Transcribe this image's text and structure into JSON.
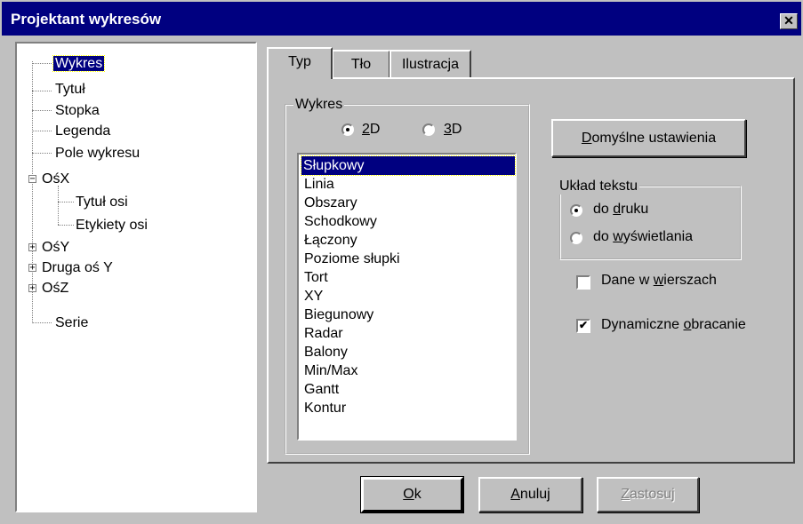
{
  "window": {
    "title": "Projektant wykresów",
    "close_glyph": "✕"
  },
  "tree": {
    "items": [
      {
        "label": "Wykres",
        "selected": true
      },
      {
        "label": "Tytuł"
      },
      {
        "label": "Stopka"
      },
      {
        "label": "Legenda"
      },
      {
        "label": "Pole wykresu"
      },
      {
        "label": "OśX",
        "expander": "−"
      },
      {
        "label": "Tytuł osi"
      },
      {
        "label": "Etykiety osi"
      },
      {
        "label": "OśY",
        "expander": "+"
      },
      {
        "label": "Druga oś Y",
        "expander": "+"
      },
      {
        "label": "OśZ",
        "expander": "+"
      },
      {
        "label": "Serie"
      }
    ]
  },
  "tabs": [
    {
      "label": "Typ",
      "active": true
    },
    {
      "label": "Tło"
    },
    {
      "label": "Ilustracja"
    }
  ],
  "chart_group": {
    "legend": "Wykres",
    "radio_2d": {
      "prefix": "",
      "accel": "2",
      "suffix": "D",
      "checked": true
    },
    "radio_3d": {
      "prefix": "",
      "accel": "3",
      "suffix": "D",
      "checked": false
    }
  },
  "chart_types": {
    "items": [
      "Słupkowy",
      "Linia",
      "Obszary",
      "Schodkowy",
      "Łączony",
      "Poziome słupki",
      "Tort",
      "XY",
      "Biegunowy",
      "Radar",
      "Balony",
      "Min/Max",
      "Gantt",
      "Kontur"
    ],
    "selected": "Słupkowy"
  },
  "default_button": {
    "accel": "D",
    "rest": "omyślne ustawienia"
  },
  "text_layout": {
    "legend": "Układ tekstu",
    "option_print": {
      "prefix": "do ",
      "accel": "d",
      "suffix": "ruku",
      "checked": true
    },
    "option_display": {
      "prefix": "do ",
      "accel": "w",
      "suffix": "yświetlania",
      "checked": false
    }
  },
  "checkbox_rows": {
    "prefix": "Dane w ",
    "accel": "w",
    "suffix": "ierszach",
    "checked": false,
    "mark": ""
  },
  "checkbox_rotation": {
    "prefix": "Dynamiczne ",
    "accel": "o",
    "suffix": "bracanie",
    "checked": true,
    "mark": "✔"
  },
  "buttons": {
    "ok": {
      "accel": "O",
      "rest": "k"
    },
    "cancel": {
      "accel": "A",
      "rest": "nuluj"
    },
    "apply": {
      "accel": "Z",
      "rest": "astosuj",
      "disabled": true
    }
  },
  "colors": {
    "titlebar": "#000080",
    "face": "#c0c0c0",
    "selection": "#000080"
  }
}
